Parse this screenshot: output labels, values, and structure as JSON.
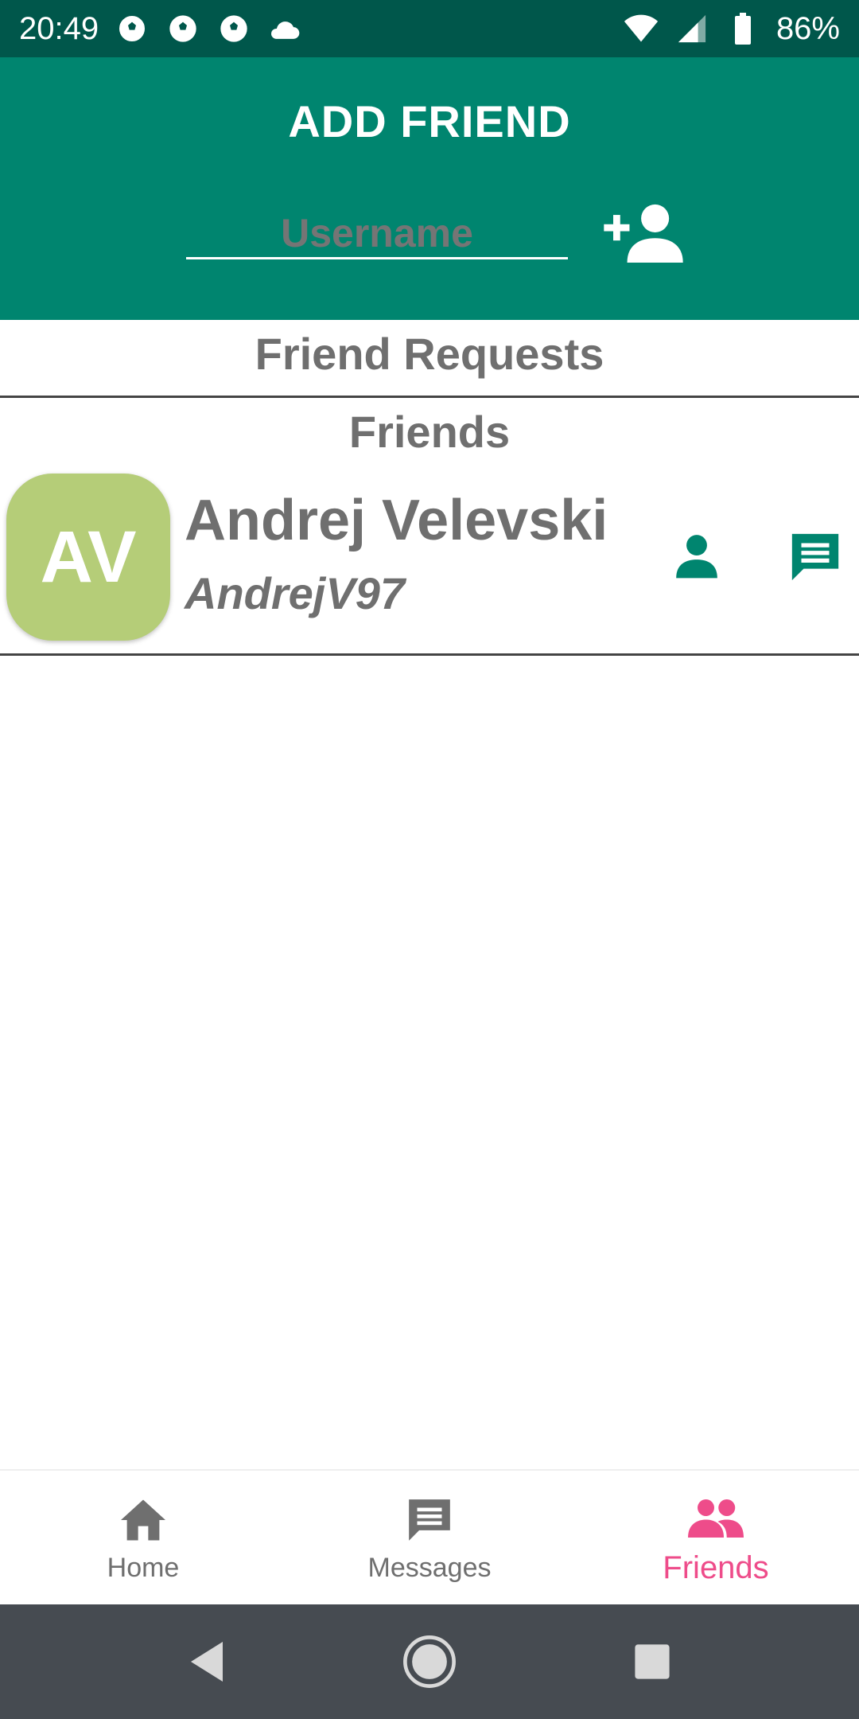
{
  "status_bar": {
    "time": "20:49",
    "battery": "86%",
    "notification_icons": [
      "soccer-ball-icon",
      "soccer-ball-icon",
      "soccer-ball-icon",
      "cloud-icon"
    ],
    "right_icons": [
      "wifi-icon",
      "signal-icon",
      "battery-icon"
    ]
  },
  "header": {
    "title": "ADD FRIEND",
    "username_placeholder": "Username",
    "username_value": "",
    "add_button_icon": "add-person-icon"
  },
  "sections": {
    "friend_requests_label": "Friend Requests",
    "friends_label": "Friends"
  },
  "friends": [
    {
      "initials": "AV",
      "name": "Andrej Velevski",
      "username": "AndrejV97",
      "avatar_color": "#b5cd78",
      "actions": [
        "person-icon",
        "chat-icon"
      ]
    }
  ],
  "bottom_nav": {
    "items": [
      {
        "label": "Home",
        "icon": "home-icon",
        "active": false
      },
      {
        "label": "Messages",
        "icon": "message-icon",
        "active": false
      },
      {
        "label": "Friends",
        "icon": "people-icon",
        "active": true
      }
    ]
  },
  "colors": {
    "primary": "#00856f",
    "primary_dark": "#00574b",
    "accent": "#ee4c8a",
    "text_gray": "#6f6f6f"
  }
}
